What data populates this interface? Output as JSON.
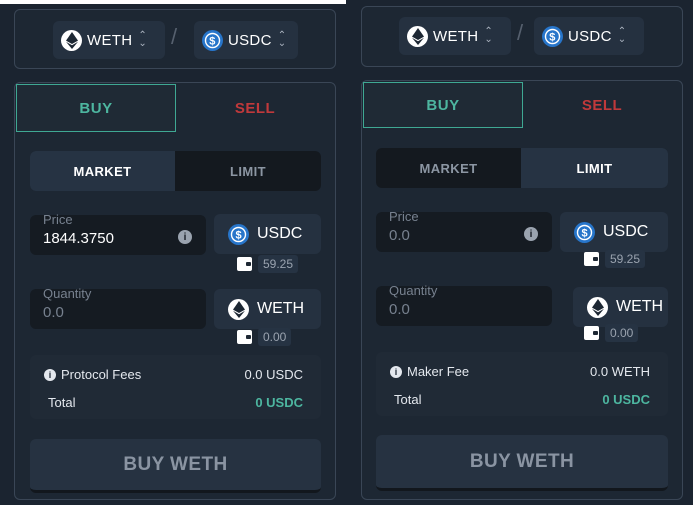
{
  "left": {
    "pair": {
      "base": "WETH",
      "quote": "USDC",
      "separator": "/"
    },
    "tabs": {
      "buy": "BUY",
      "sell": "SELL"
    },
    "order_types": {
      "market": "MARKET",
      "limit": "LIMIT",
      "active": "market"
    },
    "price": {
      "label": "Price",
      "value": "1844.3750",
      "unit": "USDC",
      "balance": "59.25"
    },
    "quantity": {
      "label": "Quantity",
      "placeholder": "0.0",
      "unit": "WETH",
      "balance": "0.00"
    },
    "fees": {
      "fee_label": "Protocol Fees",
      "fee_value": "0.0 USDC",
      "total_label": "Total",
      "total_value": "0 USDC"
    },
    "cta": "BUY WETH"
  },
  "right": {
    "pair": {
      "base": "WETH",
      "quote": "USDC",
      "separator": "/"
    },
    "tabs": {
      "buy": "BUY",
      "sell": "SELL"
    },
    "order_types": {
      "market": "MARKET",
      "limit": "LIMIT",
      "active": "limit"
    },
    "price": {
      "label": "Price",
      "placeholder": "0.0",
      "unit": "USDC",
      "balance": "59.25"
    },
    "quantity": {
      "label": "Quantity",
      "placeholder": "0.0",
      "unit": "WETH",
      "balance": "0.00"
    },
    "fees": {
      "fee_label": "Maker Fee",
      "fee_value": "0.0 WETH",
      "total_label": "Total",
      "total_value": "0 USDC"
    },
    "cta": "BUY WETH"
  },
  "colors": {
    "accent": "#4db6a0",
    "sell": "#c0393b",
    "usdc": "#2775ca",
    "background": "#1b2430"
  }
}
